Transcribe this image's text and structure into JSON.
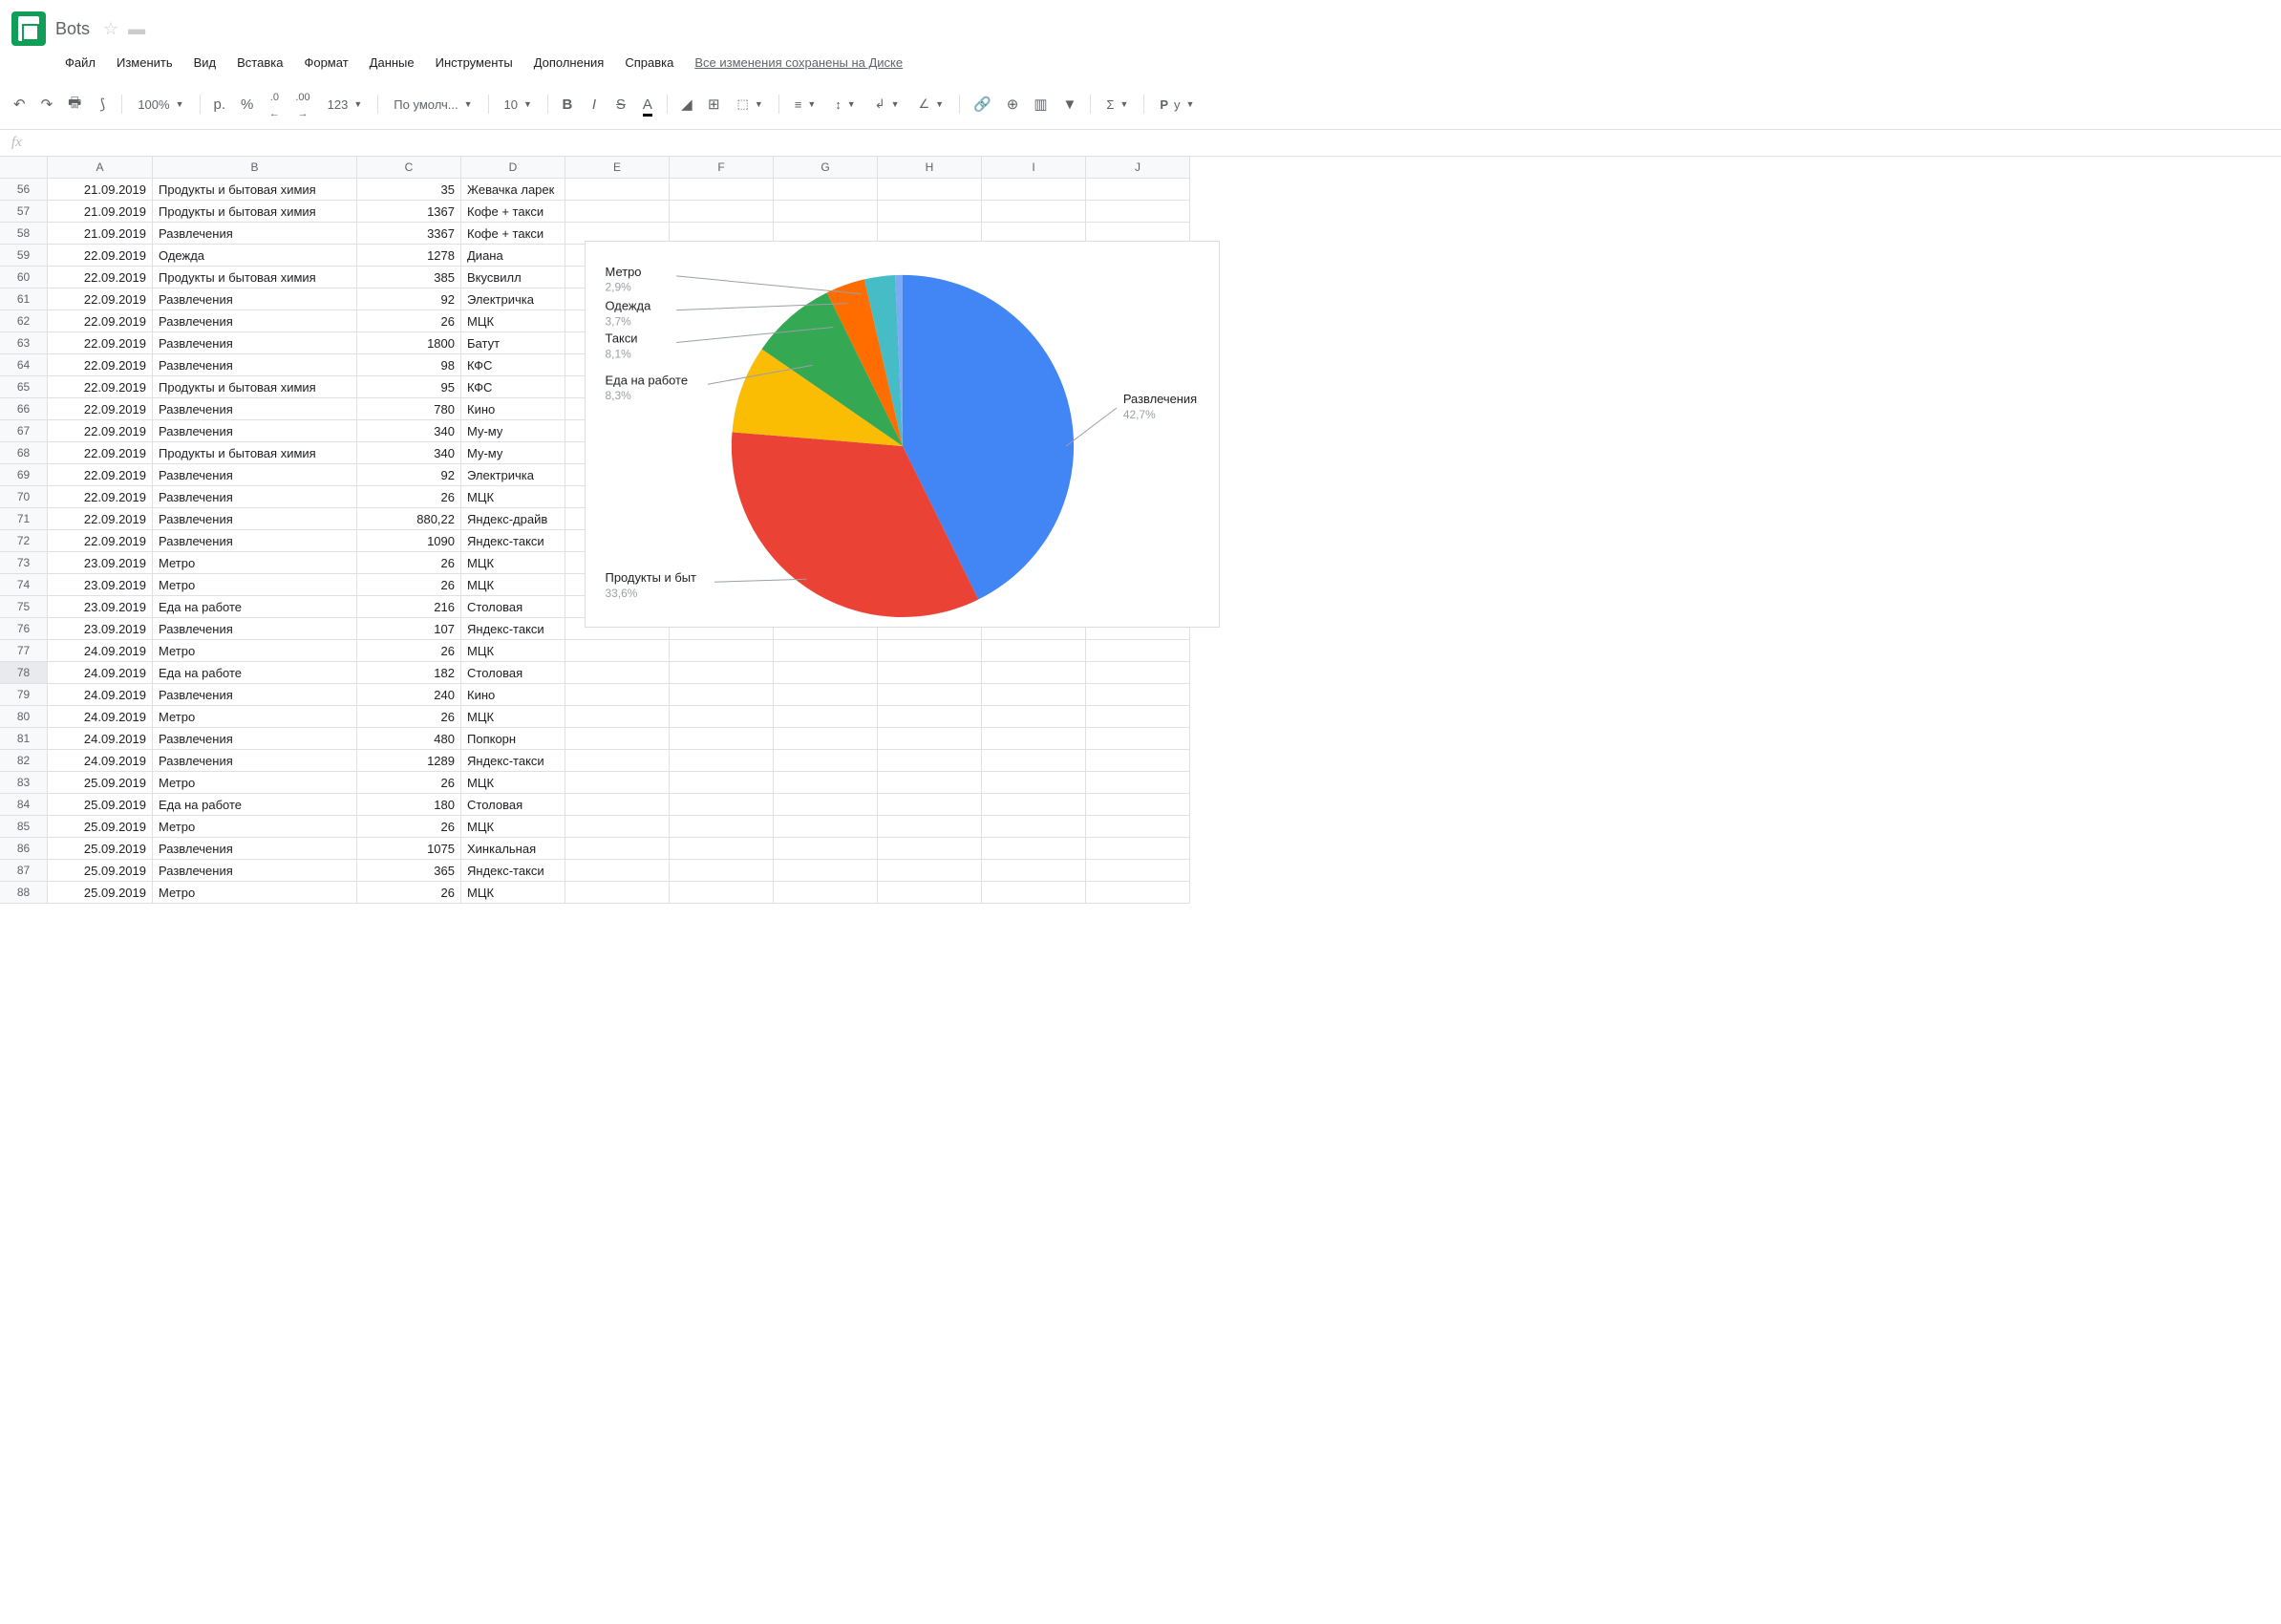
{
  "doc": {
    "title": "Bots"
  },
  "menu": {
    "file": "Файл",
    "edit": "Изменить",
    "view": "Вид",
    "insert": "Вставка",
    "format": "Формат",
    "data": "Данные",
    "tools": "Инструменты",
    "addons": "Дополнения",
    "help": "Справка",
    "save_status": "Все изменения сохранены на Диске"
  },
  "toolbar": {
    "zoom": "100%",
    "currency": "р.",
    "percent": "%",
    "dec_less": ".0",
    "dec_more": ".00",
    "more_formats": "123",
    "font": "По умолч...",
    "font_size": "10"
  },
  "columns": [
    "",
    "A",
    "B",
    "C",
    "D",
    "E",
    "F",
    "G",
    "H",
    "I",
    "J"
  ],
  "first_row": 56,
  "selected_row": 78,
  "rows": [
    [
      "21.09.2019",
      "Продукты и бытовая химия",
      "35",
      "Жевачка ларек"
    ],
    [
      "21.09.2019",
      "Продукты и бытовая химия",
      "1367",
      "Кофе + такси"
    ],
    [
      "21.09.2019",
      "Развлечения",
      "3367",
      "Кофе + такси"
    ],
    [
      "22.09.2019",
      "Одежда",
      "1278",
      "Диана"
    ],
    [
      "22.09.2019",
      "Продукты и бытовая химия",
      "385",
      "Вкусвилл"
    ],
    [
      "22.09.2019",
      "Развлечения",
      "92",
      "Электричка"
    ],
    [
      "22.09.2019",
      "Развлечения",
      "26",
      "МЦК"
    ],
    [
      "22.09.2019",
      "Развлечения",
      "1800",
      "Батут"
    ],
    [
      "22.09.2019",
      "Развлечения",
      "98",
      "КФС"
    ],
    [
      "22.09.2019",
      "Продукты и бытовая химия",
      "95",
      "КФС"
    ],
    [
      "22.09.2019",
      "Развлечения",
      "780",
      "Кино"
    ],
    [
      "22.09.2019",
      "Развлечения",
      "340",
      "Му-му"
    ],
    [
      "22.09.2019",
      "Продукты и бытовая химия",
      "340",
      "Му-му"
    ],
    [
      "22.09.2019",
      "Развлечения",
      "92",
      "Электричка"
    ],
    [
      "22.09.2019",
      "Развлечения",
      "26",
      "МЦК"
    ],
    [
      "22.09.2019",
      "Развлечения",
      "880,22",
      "Яндекс-драйв"
    ],
    [
      "22.09.2019",
      "Развлечения",
      "1090",
      "Яндекс-такси"
    ],
    [
      "23.09.2019",
      "Метро",
      "26",
      "МЦК"
    ],
    [
      "23.09.2019",
      "Метро",
      "26",
      "МЦК"
    ],
    [
      "23.09.2019",
      "Еда на работе",
      "216",
      "Столовая"
    ],
    [
      "23.09.2019",
      "Развлечения",
      "107",
      "Яндекс-такси"
    ],
    [
      "24.09.2019",
      "Метро",
      "26",
      "МЦК"
    ],
    [
      "24.09.2019",
      "Еда на работе",
      "182",
      "Столовая"
    ],
    [
      "24.09.2019",
      "Развлечения",
      "240",
      "Кино"
    ],
    [
      "24.09.2019",
      "Метро",
      "26",
      "МЦК"
    ],
    [
      "24.09.2019",
      "Развлечения",
      "480",
      "Попкорн"
    ],
    [
      "24.09.2019",
      "Развлечения",
      "1289",
      "Яндекс-такси"
    ],
    [
      "25.09.2019",
      "Метро",
      "26",
      "МЦК"
    ],
    [
      "25.09.2019",
      "Еда на работе",
      "180",
      "Столовая"
    ],
    [
      "25.09.2019",
      "Метро",
      "26",
      "МЦК"
    ],
    [
      "25.09.2019",
      "Развлечения",
      "1075",
      "Хинкальная"
    ],
    [
      "25.09.2019",
      "Развлечения",
      "365",
      "Яндекс-такси"
    ],
    [
      "25.09.2019",
      "Метро",
      "26",
      "МЦК"
    ]
  ],
  "chart_data": {
    "type": "pie",
    "series": [
      {
        "name": "Развлечения",
        "pct": 42.7,
        "color": "#4285f4"
      },
      {
        "name": "Продукты и быт",
        "pct": 33.6,
        "color": "#ea4335"
      },
      {
        "name": "Еда на работе",
        "pct": 8.3,
        "color": "#fbbc04"
      },
      {
        "name": "Такси",
        "pct": 8.1,
        "color": "#34a853"
      },
      {
        "name": "Одежда",
        "pct": 3.7,
        "color": "#ff6d01"
      },
      {
        "name": "Метро",
        "pct": 2.9,
        "color": "#46bdc6"
      },
      {
        "name": "",
        "pct": 0.7,
        "color": "#7baaf7"
      }
    ],
    "labels": [
      {
        "name": "Метро",
        "pct": "2,9%",
        "x": 20,
        "y": 36
      },
      {
        "name": "Одежда",
        "pct": "3,7%",
        "x": 20,
        "y": 72
      },
      {
        "name": "Такси",
        "pct": "8,1%",
        "x": 20,
        "y": 106
      },
      {
        "name": "Еда на работе",
        "pct": "8,3%",
        "x": 20,
        "y": 150
      },
      {
        "name": "Продукты и быт",
        "pct": "33,6%",
        "x": 20,
        "y": 358
      },
      {
        "name": "Развлечения",
        "pct": "42,7%",
        "x": 565,
        "y": 170
      }
    ]
  }
}
